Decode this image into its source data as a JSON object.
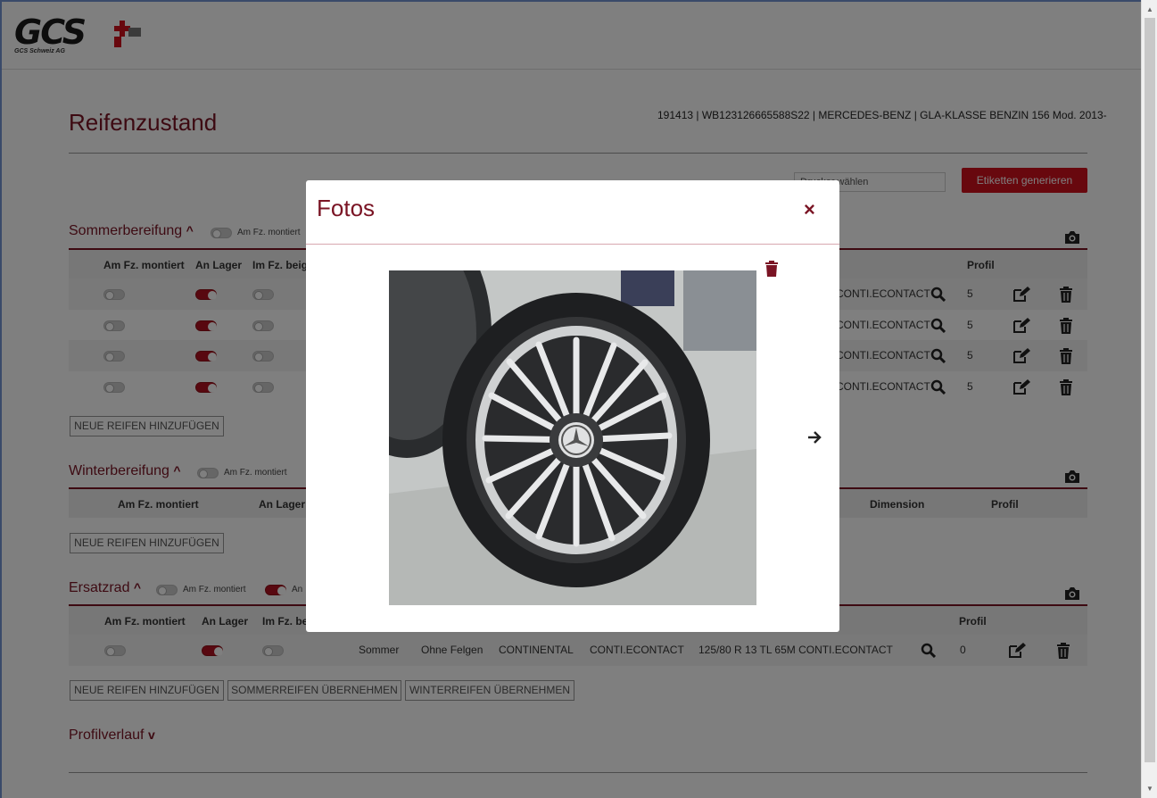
{
  "header": {
    "logo_text": "GCS",
    "logo_sub": "GCS Schweiz AG"
  },
  "page": {
    "title": "Reifenzustand",
    "vehicle_info": "191413 | WB123126665588S22 | MERCEDES-BENZ | GLA-KLASSE BENZIN 156 Mod. 2013-",
    "select_placeholder": "Drucker wählen",
    "generate_labels_button": "Etiketten generieren"
  },
  "summer": {
    "title": "Sommerbereifung",
    "toggle_label": "Am Fz. montiert",
    "columns": [
      "Am Fz. montiert",
      "An Lager",
      "Im Fz. beig",
      "Profil"
    ],
    "rows": [
      {
        "model": "CONTI.ECONTACT",
        "profil": "5",
        "am_fz": false,
        "an_lager": true,
        "im_fz": false
      },
      {
        "model": "CONTI.ECONTACT",
        "profil": "5",
        "am_fz": false,
        "an_lager": true,
        "im_fz": false
      },
      {
        "model": "CONTI.ECONTACT",
        "profil": "5",
        "am_fz": false,
        "an_lager": true,
        "im_fz": false
      },
      {
        "model": "CONTI.ECONTACT",
        "profil": "5",
        "am_fz": false,
        "an_lager": true,
        "im_fz": false
      }
    ],
    "add_button": "NEUE REIFEN HINZUFÜGEN"
  },
  "winter": {
    "title": "Winterbereifung",
    "toggle_label": "Am Fz. montiert",
    "columns": [
      "Am Fz. montiert",
      "An Lager",
      "Dimension",
      "Profil"
    ],
    "add_button": "NEUE REIFEN HINZUFÜGEN"
  },
  "spare": {
    "title": "Ersatzrad",
    "toggle_label": "Am Fz. montiert",
    "toggle2_label": "An",
    "columns": [
      "Am Fz. montiert",
      "An Lager",
      "Im Fz. be",
      "Profil"
    ],
    "row": {
      "saison": "Sommer",
      "felgen": "Ohne Felgen",
      "marke": "CONTINENTAL",
      "modell": "CONTI.ECONTACT",
      "dimension": "125/80 R 13 TL 65M CONTI.ECONTACT",
      "profil": "0",
      "am_fz": false,
      "an_lager": true,
      "im_fz": false
    },
    "add_button": "NEUE REIFEN HINZUFÜGEN",
    "copy_summer_button": "SOMMERREIFEN ÜBERNEHMEN",
    "copy_winter_button": "WINTERREIFEN ÜBERNEHMEN"
  },
  "profile": {
    "title": "Profilverlauf"
  },
  "modal": {
    "title": "Fotos",
    "close": "×"
  },
  "colors": {
    "brand": "#7a1424",
    "accent_red": "#d0101c"
  }
}
